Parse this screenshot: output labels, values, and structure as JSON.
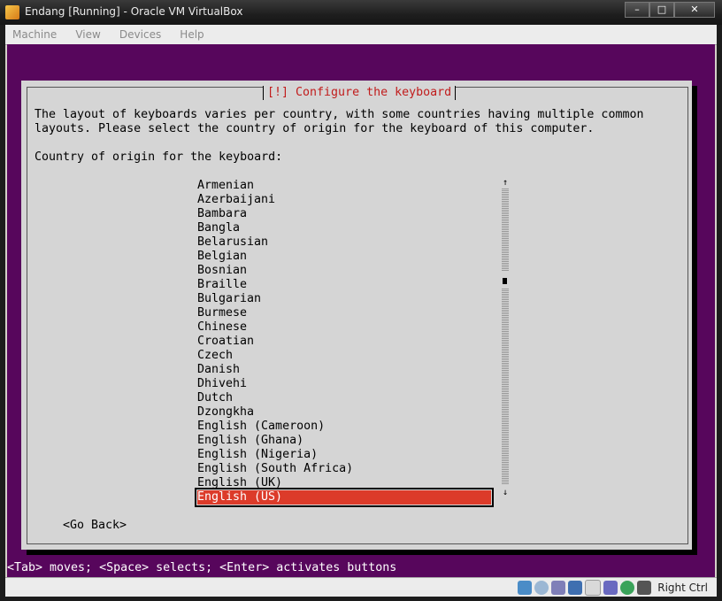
{
  "window": {
    "title": "Endang [Running] - Oracle VM VirtualBox",
    "minimize": "–",
    "maximize": "□",
    "close": "✕"
  },
  "menu": [
    "Machine",
    "View",
    "Devices",
    "Help"
  ],
  "dialog": {
    "title": "[!] Configure the keyboard",
    "intro": "The layout of keyboards varies per country, with some countries having multiple common\nlayouts. Please select the country of origin for the keyboard of this computer.",
    "label": "Country of origin for the keyboard:",
    "items": [
      "Armenian",
      "Azerbaijani",
      "Bambara",
      "Bangla",
      "Belarusian",
      "Belgian",
      "Bosnian",
      "Braille",
      "Bulgarian",
      "Burmese",
      "Chinese",
      "Croatian",
      "Czech",
      "Danish",
      "Dhivehi",
      "Dutch",
      "Dzongkha",
      "English (Cameroon)",
      "English (Ghana)",
      "English (Nigeria)",
      "English (South Africa)",
      "English (UK)",
      "English (US)"
    ],
    "selected_index": 22,
    "scroll_up": "↑",
    "scroll_down": "↓",
    "go_back": "<Go Back>"
  },
  "helpline": "<Tab> moves; <Space> selects; <Enter> activates buttons",
  "statusbar": {
    "host_key": "Right Ctrl",
    "icons": [
      "hard-disk-icon",
      "optical-drive-icon",
      "usb-icon",
      "network-icon",
      "shared-folders-icon",
      "display-icon",
      "capture-icon",
      "mouse-integration-icon"
    ]
  },
  "colors": {
    "vm_background": "#57065c",
    "dialog": "#d5d5d5",
    "selection": "#dc3b2a",
    "dialog_title": "#c11c1c"
  }
}
